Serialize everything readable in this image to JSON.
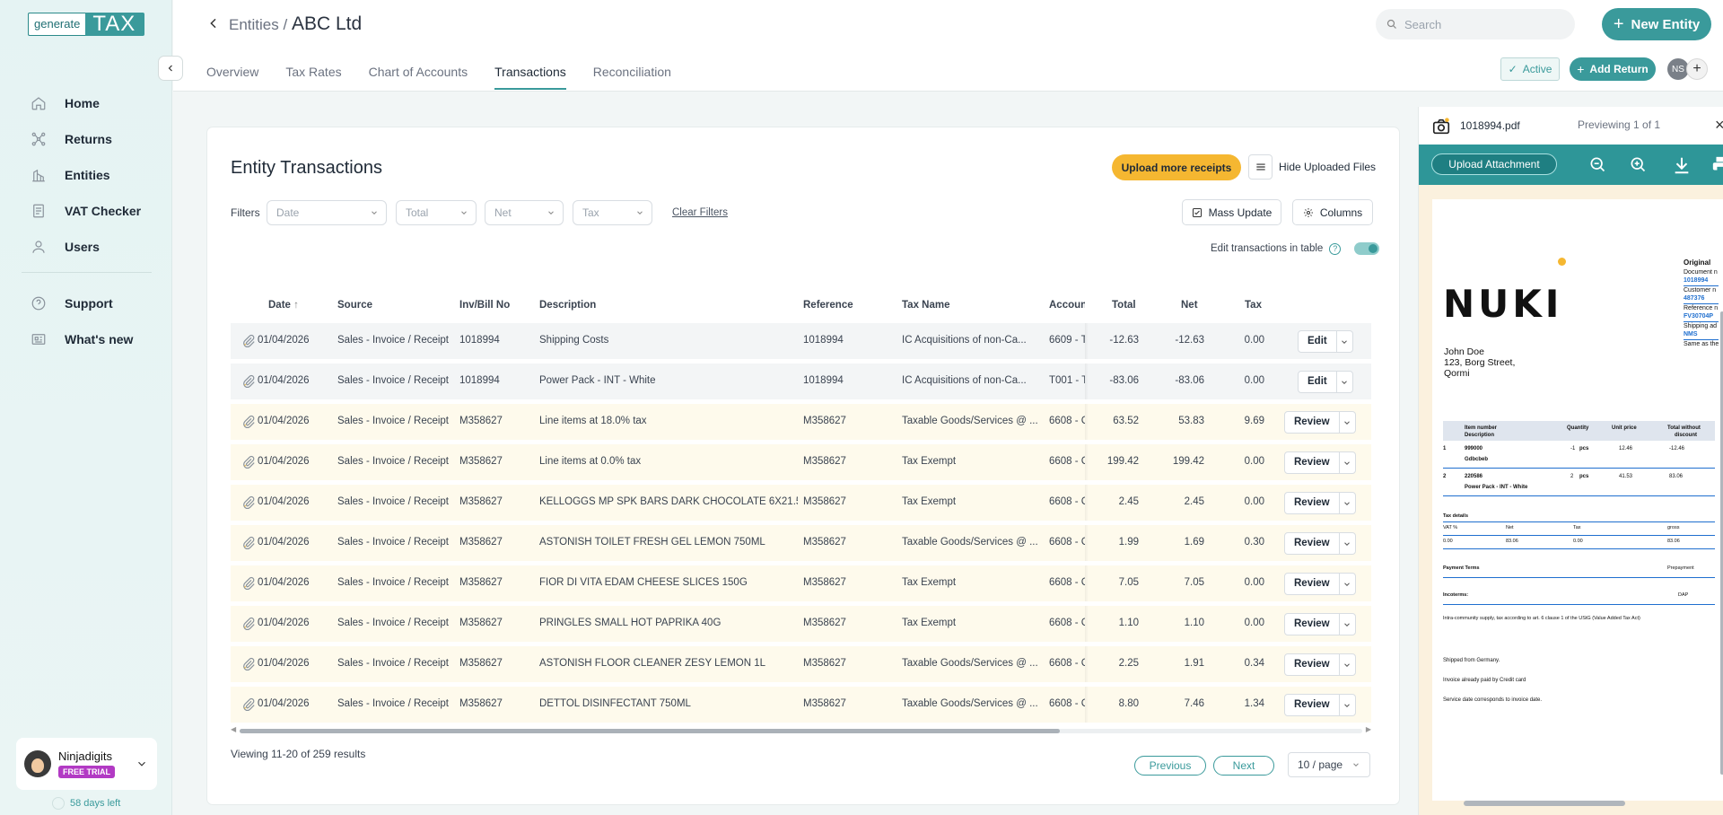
{
  "app": {
    "logo_left": "generate",
    "logo_right": "TAX"
  },
  "sidebar": {
    "items": [
      {
        "label": "Home",
        "icon": "home-icon"
      },
      {
        "label": "Returns",
        "icon": "returns-icon"
      },
      {
        "label": "Entities",
        "icon": "entities-icon"
      },
      {
        "label": "VAT Checker",
        "icon": "vat-checker-icon"
      },
      {
        "label": "Users",
        "icon": "users-icon"
      }
    ],
    "secondary": [
      {
        "label": "Support",
        "icon": "help-icon"
      },
      {
        "label": "What's new",
        "icon": "news-icon"
      }
    ],
    "user": {
      "name": "Ninjadigits",
      "plan": "FREE TRIAL",
      "days_left": "58 days left"
    }
  },
  "header": {
    "breadcrumb_parent": "Entities /",
    "entity_name": "ABC Ltd",
    "tabs": [
      "Overview",
      "Tax Rates",
      "Chart of Accounts",
      "Transactions",
      "Reconciliation"
    ],
    "active_tab": "Transactions",
    "search_placeholder": "Search",
    "new_entity": "New Entity",
    "status": "Active",
    "add_return": "Add Return",
    "user_initials": "NS"
  },
  "main": {
    "title": "Entity Transactions",
    "upload_more": "Upload more receipts",
    "hide_files": "Hide Uploaded Files",
    "filters_label": "Filters",
    "filters": [
      "Date",
      "Total",
      "Net",
      "Tax"
    ],
    "clear_filters": "Clear Filters",
    "mass_update": "Mass Update",
    "columns": "Columns",
    "edit_in_table": "Edit transactions in table",
    "edit_in_table_on": true,
    "table": {
      "headers": [
        "Date",
        "Source",
        "Inv/Bill No",
        "Description",
        "Reference",
        "Tax Name",
        "Accoun",
        "Total",
        "Net",
        "Tax"
      ],
      "rows": [
        {
          "date": "01/04/2026",
          "source": "Sales - Invoice / Receipt",
          "inv": "1018994",
          "desc": "Shipping Costs",
          "ref": "1018994",
          "tax_name": "IC Acquisitions of non-Ca...",
          "account": "6609 - T",
          "total": "-12.63",
          "net": "-12.63",
          "tax": "0.00",
          "action": "Edit",
          "state": "reviewed"
        },
        {
          "date": "01/04/2026",
          "source": "Sales - Invoice / Receipt",
          "inv": "1018994",
          "desc": "Power Pack - INT - White",
          "ref": "1018994",
          "tax_name": "IC Acquisitions of non-Ca...",
          "account": "T001 - T",
          "total": "-83.06",
          "net": "-83.06",
          "tax": "0.00",
          "action": "Edit",
          "state": "reviewed"
        },
        {
          "date": "01/04/2026",
          "source": "Sales - Invoice / Receipt",
          "inv": "M358627",
          "desc": "Line items at 18.0% tax",
          "ref": "M358627",
          "tax_name": "Taxable Goods/Services @ ...",
          "account": "6608 - C",
          "total": "63.52",
          "net": "53.83",
          "tax": "9.69",
          "action": "Review",
          "state": "pending"
        },
        {
          "date": "01/04/2026",
          "source": "Sales - Invoice / Receipt",
          "inv": "M358627",
          "desc": "Line items at 0.0% tax",
          "ref": "M358627",
          "tax_name": "Tax Exempt",
          "account": "6608 - C",
          "total": "199.42",
          "net": "199.42",
          "tax": "0.00",
          "action": "Review",
          "state": "pending"
        },
        {
          "date": "01/04/2026",
          "source": "Sales - Invoice / Receipt",
          "inv": "M358627",
          "desc": "KELLOGGS MP SPK BARS DARK CHOCOLATE 6X21.5G",
          "ref": "M358627",
          "tax_name": "Tax Exempt",
          "account": "6608 - C",
          "total": "2.45",
          "net": "2.45",
          "tax": "0.00",
          "action": "Review",
          "state": "pending"
        },
        {
          "date": "01/04/2026",
          "source": "Sales - Invoice / Receipt",
          "inv": "M358627",
          "desc": "ASTONISH TOILET FRESH GEL LEMON 750ML",
          "ref": "M358627",
          "tax_name": "Taxable Goods/Services @ ...",
          "account": "6608 - C",
          "total": "1.99",
          "net": "1.69",
          "tax": "0.30",
          "action": "Review",
          "state": "pending"
        },
        {
          "date": "01/04/2026",
          "source": "Sales - Invoice / Receipt",
          "inv": "M358627",
          "desc": "FIOR DI VITA EDAM CHEESE SLICES 150G",
          "ref": "M358627",
          "tax_name": "Tax Exempt",
          "account": "6608 - C",
          "total": "7.05",
          "net": "7.05",
          "tax": "0.00",
          "action": "Review",
          "state": "pending"
        },
        {
          "date": "01/04/2026",
          "source": "Sales - Invoice / Receipt",
          "inv": "M358627",
          "desc": "PRINGLES SMALL HOT PAPRIKA 40G",
          "ref": "M358627",
          "tax_name": "Tax Exempt",
          "account": "6608 - C",
          "total": "1.10",
          "net": "1.10",
          "tax": "0.00",
          "action": "Review",
          "state": "pending"
        },
        {
          "date": "01/04/2026",
          "source": "Sales - Invoice / Receipt",
          "inv": "M358627",
          "desc": "ASTONISH FLOOR CLEANER ZESY LEMON 1L",
          "ref": "M358627",
          "tax_name": "Taxable Goods/Services @ ...",
          "account": "6608 - C",
          "total": "2.25",
          "net": "1.91",
          "tax": "0.34",
          "action": "Review",
          "state": "pending"
        },
        {
          "date": "01/04/2026",
          "source": "Sales - Invoice / Receipt",
          "inv": "M358627",
          "desc": "DETTOL DISINFECTANT 750ML",
          "ref": "M358627",
          "tax_name": "Taxable Goods/Services @ ...",
          "account": "6608 - C",
          "total": "8.80",
          "net": "7.46",
          "tax": "1.34",
          "action": "Review",
          "state": "pending"
        }
      ]
    },
    "viewing": "Viewing 11-20 of 259 results",
    "previous": "Previous",
    "next": "Next",
    "per_page": "10 / page"
  },
  "preview": {
    "file_name": "1018994.pdf",
    "count": "Previewing 1 of 1",
    "upload_attachment": "Upload Attachment",
    "doc": {
      "brand": "NUKI",
      "address": [
        "John Doe",
        "123, Borg Street,",
        "Qormi"
      ],
      "right_title": "Original",
      "right_lines": [
        "Document n",
        "1018994",
        "Customer n",
        "487376",
        "Reference n",
        "FV30704P",
        "Shipping ad",
        "NMS",
        "Same as the"
      ],
      "items_header": [
        "Item number",
        "Quantity",
        "Unit price",
        "Total without"
      ],
      "items_header2": [
        "Description",
        "discount"
      ],
      "items": [
        {
          "pos": "1",
          "num": "999000",
          "desc": "Gdbcbeb",
          "qty": "-1",
          "unit": "pcs",
          "price": "12.46",
          "total": "-12.46"
        },
        {
          "pos": "2",
          "num": "220586",
          "desc": "Power Pack - INT - White",
          "qty": "2",
          "unit": "pcs",
          "price": "41.53",
          "total": "83.06"
        }
      ],
      "tax_details": "Tax details",
      "tax_cols": [
        "VAT %",
        "Net",
        "Tax",
        "gross"
      ],
      "tax_vals": [
        "0.00",
        "83.06",
        "0.00",
        "83.06"
      ],
      "payment_terms": "Payment Terms",
      "prepayment": "Prepayment",
      "incoterms": "Incoterms:",
      "incoterms_val": "DAP",
      "note1": "Intra-community supply, tax according to art. 6 clause 1 of the UStG (Value Added Tax Act)",
      "note2": "Shipped from Germany.",
      "note3": "Invoice already paid by Credit card",
      "note4": "Service date corresponds to invoice date."
    }
  },
  "colors": {
    "accent": "#3a9a9b",
    "upload_more": "#f5b731",
    "trial_badge": "#b23ac4",
    "pending_row": "#fefaec",
    "reviewed_row": "#f3f5f6"
  }
}
